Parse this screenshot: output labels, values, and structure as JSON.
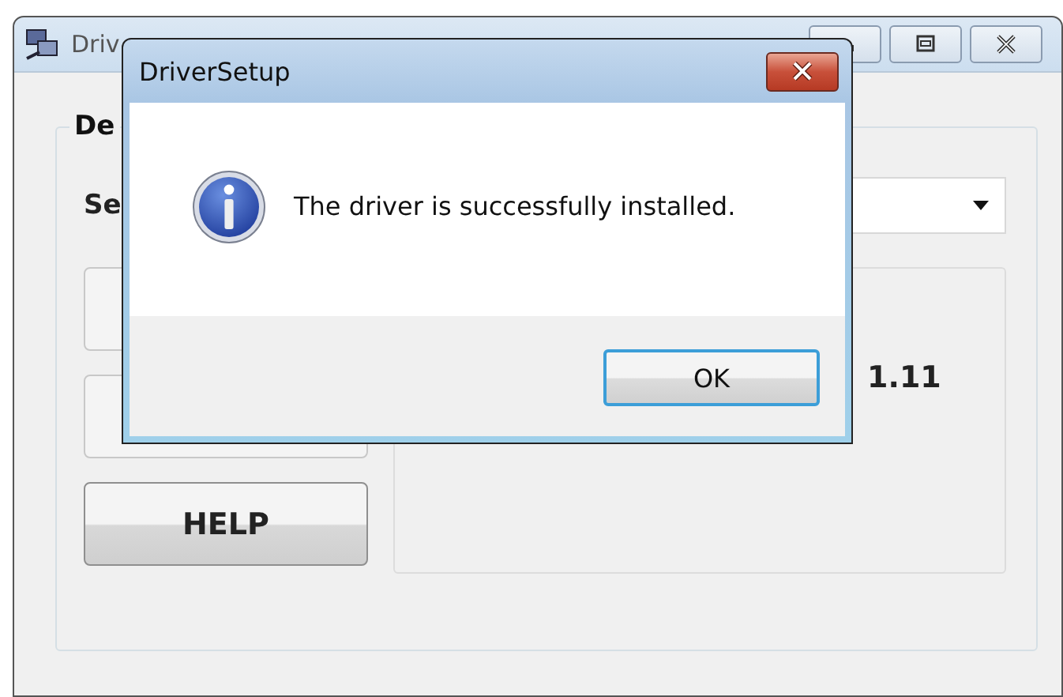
{
  "main_window": {
    "title": "Driv",
    "group_label": "De",
    "select_label": "Se",
    "buttons": [
      "HELP"
    ],
    "info_text": "1.11"
  },
  "dialog": {
    "title": "DriverSetup",
    "message": "The driver is successfully installed.",
    "buttons": [
      "OK"
    ]
  }
}
